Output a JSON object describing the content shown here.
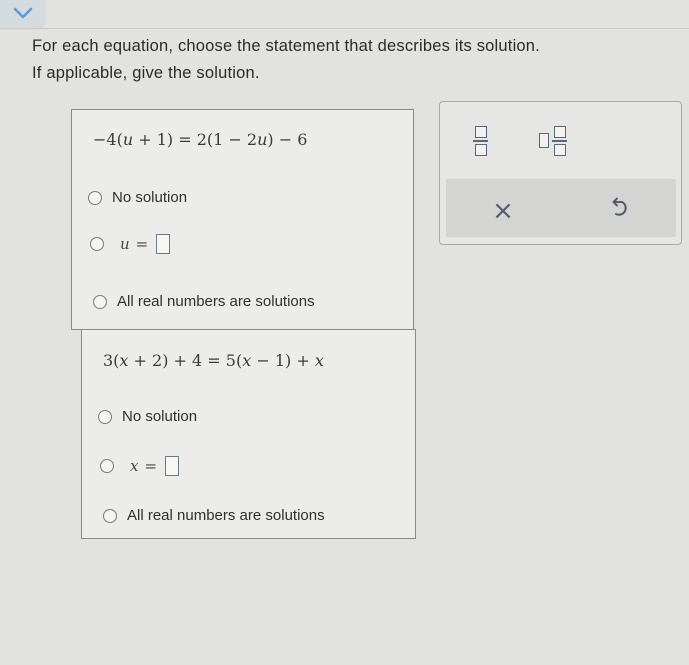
{
  "header": {
    "prompt_line1": "For each equation, choose the statement that describes its solution.",
    "prompt_line2": "If applicable, give the solution."
  },
  "equations": [
    {
      "lhs_coef": "−4(",
      "lhs_var": "u",
      "lhs_rest": " + 1) = 2(1 − 2",
      "rhs_var": "u",
      "rhs_rest": ") − 6",
      "option_no_solution": "No solution",
      "variable": "u",
      "equals": "=",
      "option_all_real": "All real numbers are solutions"
    },
    {
      "lhs_coef": "3(",
      "lhs_var": "x",
      "lhs_rest": " + 2) + 4 = 5(",
      "rhs_var": "x",
      "rhs_rest": " − 1) + ",
      "tail_var": "x",
      "option_no_solution": "No solution",
      "variable": "x",
      "equals": "=",
      "option_all_real": "All real numbers are solutions"
    }
  ],
  "toolbar": {
    "clear_symbol": "×",
    "undo_symbol": "↺"
  },
  "colors": {
    "background": "#e2e2e0",
    "box_background": "#ececea",
    "accent_tab": "#d5dce0",
    "chevron": "#5b9bd5"
  },
  "icons": [
    "chevron-down-icon",
    "fraction-icon",
    "mixed-number-icon",
    "clear-icon",
    "undo-icon"
  ]
}
